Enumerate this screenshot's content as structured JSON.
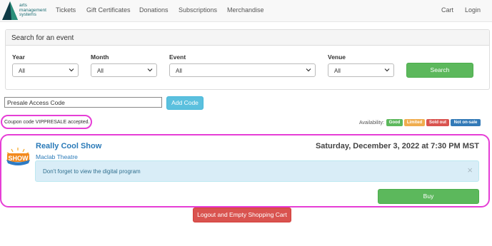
{
  "brand": {
    "lines": [
      "arts",
      "management",
      "systems"
    ],
    "colors": {
      "teal": "#1a6c72",
      "dark": "#0e3b45"
    }
  },
  "nav": {
    "left": [
      "Tickets",
      "Gift Certificates",
      "Donations",
      "Subscriptions",
      "Merchandise"
    ],
    "right": [
      "Cart",
      "Login"
    ]
  },
  "search": {
    "title": "Search for an event",
    "fields": [
      {
        "label": "Year",
        "value": "All"
      },
      {
        "label": "Month",
        "value": "All"
      },
      {
        "label": "Event",
        "value": "All"
      },
      {
        "label": "Venue",
        "value": "All"
      }
    ],
    "button": "Search"
  },
  "presale": {
    "value": "Presale Access Code",
    "button": "Add Code",
    "coupon_message": "Coupon code VIPPRESALE accepted."
  },
  "availability": {
    "label": "Availability:",
    "badges": [
      {
        "text": "Good",
        "color": "#5cb85c"
      },
      {
        "text": "Limited",
        "color": "#f0ad4e"
      },
      {
        "text": "Sold out",
        "color": "#d9534f"
      },
      {
        "text": "Not on-sale",
        "color": "#337ab7"
      }
    ]
  },
  "event": {
    "title": "Really Cool Show",
    "date": "Saturday, December 3, 2022 at 7:30 PM MST",
    "venue": "Maclab Theatre",
    "alert": "Don't forget to view the digital program",
    "close": "×",
    "buy": "Buy",
    "logo_text": "SHOW"
  },
  "logout_button": "Logout and Empty Shopping Cart",
  "highlight_color": "#e63ed6"
}
